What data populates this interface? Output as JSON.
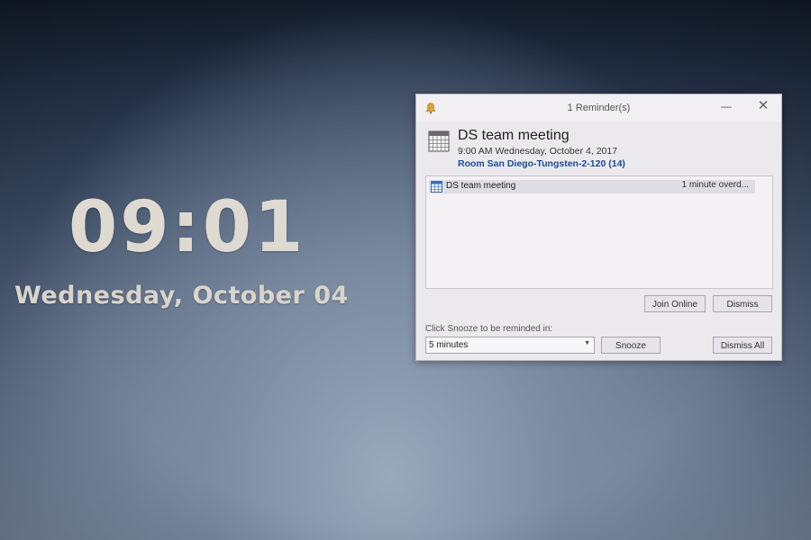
{
  "lock_screen": {
    "time": "09:01",
    "date": "Wednesday, October 04"
  },
  "reminder_window": {
    "title": "1 Reminder(s)",
    "controls": {
      "minimize": "—",
      "close": "✕"
    },
    "subject": "DS team meeting",
    "when": "9:00 AM Wednesday, October 4, 2017",
    "location": "Room San Diego-Tungsten-2-120 (14)",
    "list": [
      {
        "subject": "DS team meeting",
        "due": "1 minute overd..."
      }
    ],
    "buttons": {
      "join_online": "Join Online",
      "dismiss": "Dismiss",
      "snooze": "Snooze",
      "dismiss_all": "Dismiss All"
    },
    "snooze_label": "Click Snooze to be reminded in:",
    "snooze_select": {
      "value": "5 minutes",
      "arrow": "▼"
    }
  },
  "colors": {
    "location_text": "#1a4a9a",
    "window_bg": "#ece9ec",
    "bell": "#d9a233"
  },
  "icons": [
    "bell-icon",
    "calendar-icon",
    "calendar-small-icon",
    "dropdown-arrow-icon"
  ]
}
